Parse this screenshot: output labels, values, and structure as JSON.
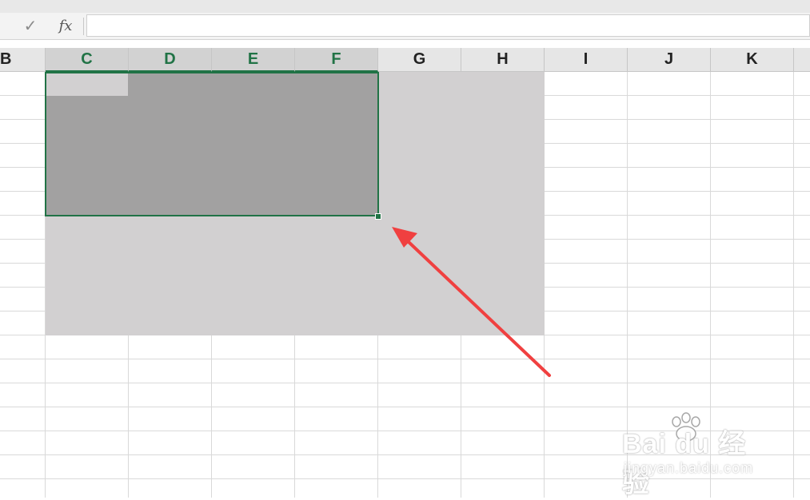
{
  "formula_bar": {
    "confirm_icon": "check-icon",
    "fx_label": "fx",
    "value": ""
  },
  "columns": [
    {
      "label": "B",
      "selected": false
    },
    {
      "label": "C",
      "selected": true
    },
    {
      "label": "D",
      "selected": true
    },
    {
      "label": "E",
      "selected": true
    },
    {
      "label": "F",
      "selected": true
    },
    {
      "label": "G",
      "selected": false
    },
    {
      "label": "H",
      "selected": false
    },
    {
      "label": "I",
      "selected": false
    },
    {
      "label": "J",
      "selected": false
    },
    {
      "label": "K",
      "selected": false
    }
  ],
  "colors": {
    "accent": "#217346",
    "arrow": "#f04040",
    "selection_light": "#d2d0d1",
    "selection_dark": "#a2a1a1"
  },
  "watermark": {
    "brand": "Bai  du 经验",
    "url": "jingyan.baidu.com"
  }
}
